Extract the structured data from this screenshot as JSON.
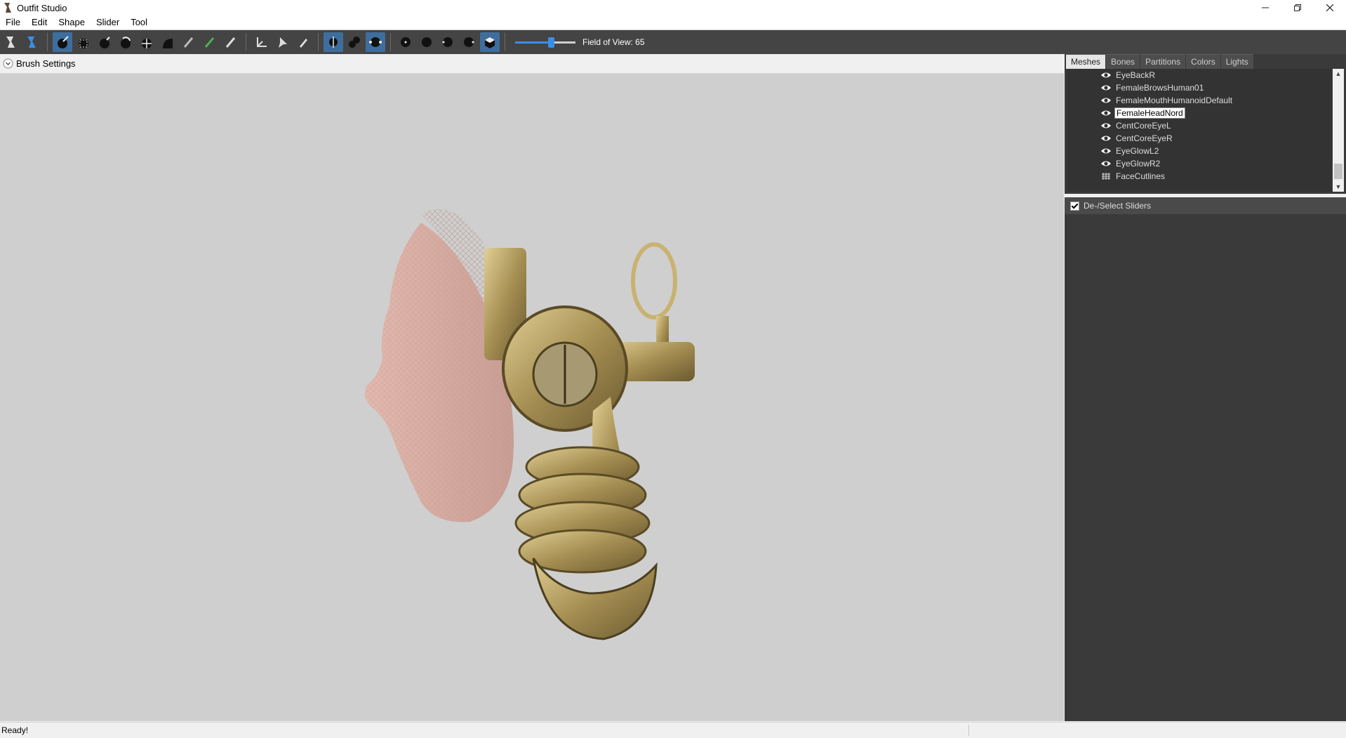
{
  "window": {
    "title": "Outfit Studio",
    "icon": "outfit-studio-icon"
  },
  "menu": {
    "items": [
      "File",
      "Edit",
      "Shape",
      "Slider",
      "Tool"
    ]
  },
  "toolbar": {
    "field_of_view_label": "Field of View: 65",
    "field_of_view_value": 65,
    "fov_range": [
      10,
      100
    ]
  },
  "brush_settings": {
    "label": "Brush Settings"
  },
  "panel": {
    "tabs": [
      "Meshes",
      "Bones",
      "Partitions",
      "Colors",
      "Lights"
    ],
    "active_tab": "Meshes",
    "meshes": [
      {
        "name": "EyeBackR",
        "icon": "eye-icon"
      },
      {
        "name": "FemaleBrowsHuman01",
        "icon": "eye-icon"
      },
      {
        "name": "FemaleMouthHumanoidDefault",
        "icon": "eye-icon"
      },
      {
        "name": "FemaleHeadNord",
        "icon": "eye-icon",
        "selected": true
      },
      {
        "name": "CentCoreEyeL",
        "icon": "eye-icon"
      },
      {
        "name": "CentCoreEyeR",
        "icon": "eye-icon"
      },
      {
        "name": "EyeGlowL2",
        "icon": "eye-icon"
      },
      {
        "name": "EyeGlowR2",
        "icon": "eye-icon"
      },
      {
        "name": "FaceCutlines",
        "icon": "grid-icon"
      }
    ],
    "sliders_header": "De-/Select Sliders"
  },
  "status": {
    "text": "Ready!"
  },
  "colors": {
    "toolbar_bg": "#444444",
    "panel_bg": "#3a3a3a",
    "viewport_bg": "#cfcfcf",
    "accent": "#3a8ee6"
  }
}
